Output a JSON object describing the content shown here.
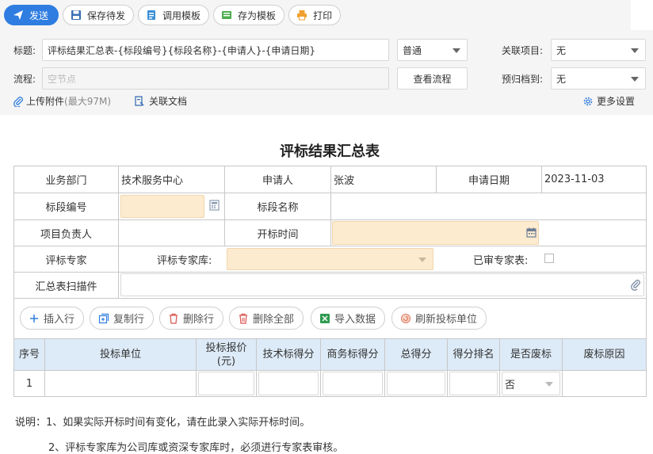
{
  "toolbar": {
    "send": "发送",
    "save_pending": "保存待发",
    "use_template": "调用模板",
    "save_template": "存为模板",
    "print": "打印"
  },
  "header": {
    "title_label": "标题:",
    "title_value": "评标结果汇总表-{标段编号}{标段名称}-{申请人}-{申请日期}",
    "priority_value": "普通",
    "related_project_label": "关联项目:",
    "related_project_value": "无",
    "flow_label": "流程:",
    "flow_placeholder": "空节点",
    "view_flow": "查看流程",
    "archive_label": "预归档到:",
    "archive_value": "无",
    "upload": "上传附件",
    "upload_hint": "(最大97M)",
    "related_docs": "关联文档",
    "more_settings": "更多设置"
  },
  "form": {
    "title": "评标结果汇总表",
    "dept_label": "业务部门",
    "dept_value": "技术服务中心",
    "applicant_label": "申请人",
    "applicant_value": "张波",
    "date_label": "申请日期",
    "date_value": "2023-11-03",
    "section_no_label": "标段编号",
    "section_name_label": "标段名称",
    "pm_label": "项目负责人",
    "open_time_label": "开标时间",
    "expert_label": "评标专家",
    "expert_lib_label": "评标专家库:",
    "reviewed_label": "已审专家表:",
    "scan_label": "汇总表扫描件"
  },
  "grid_buttons": {
    "insert_row": "插入行",
    "copy_row": "复制行",
    "delete_row": "删除行",
    "delete_all": "删除全部",
    "import_data": "导入数据",
    "refresh_bidders": "刷新投标单位"
  },
  "table": {
    "headers": [
      "序号",
      "投标单位",
      "投标报价(元)",
      "技术标得分",
      "商务标得分",
      "总得分",
      "得分排名",
      "是否废标",
      "废标原因"
    ],
    "row1": {
      "index": "1",
      "void": "否"
    }
  },
  "notes": {
    "line1": "说明：1、如果实际开标时间有变化，请在此录入实际开标时间。",
    "line2": "2、评标专家库为公司库或资深专家库时，必须进行专家表审核。"
  },
  "colors": {
    "primary": "#2f7de1",
    "highlight_input": "#fdebd0",
    "table_header": "#ddeaf7"
  }
}
